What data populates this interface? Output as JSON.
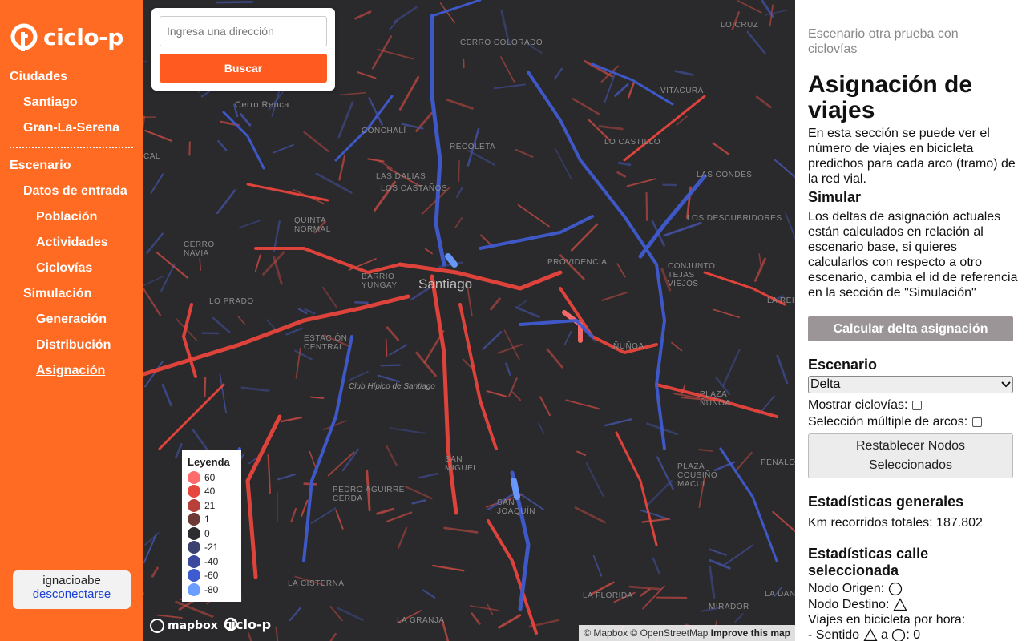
{
  "app": {
    "brand": "ciclo-p"
  },
  "sidebar": {
    "items": [
      {
        "label": "Ciudades"
      },
      {
        "label": "Santiago"
      },
      {
        "label": "Gran-La-Serena"
      },
      {
        "label": "Escenario"
      },
      {
        "label": "Datos de entrada"
      },
      {
        "label": "Población"
      },
      {
        "label": "Actividades"
      },
      {
        "label": "Ciclovías"
      },
      {
        "label": "Simulación"
      },
      {
        "label": "Generación"
      },
      {
        "label": "Distribución"
      },
      {
        "label": "Asignación",
        "active": true
      }
    ],
    "user": {
      "name": "ignacioabe",
      "logout": "desconectarse"
    }
  },
  "search": {
    "placeholder": "Ingresa una dirección",
    "button": "Buscar"
  },
  "map": {
    "city_label": "Santiago",
    "labels": [
      "LO CRUZ",
      "CERRO COLORADO",
      "Cerro Renca",
      "VITACURA",
      "CONCHALÍ",
      "RECOLETA",
      "LO CASTILLO",
      "LAS DALIAS",
      "LOS CASTAÑOS",
      "LAS CONDES",
      "QUINTA NORMAL",
      "LOS DESCUBRIDORES",
      "CERRO NAVIA",
      "PROVIDENCIA",
      "CONJUNTO TEJAS VIEJOS",
      "BARRIO YUNGAY",
      "LO PRADO",
      "LA REINA",
      "ESTACIÓN CENTRAL",
      "ÑUÑOA",
      "PLAZA ÑUÑOA",
      "SAN MIGUEL",
      "PEDRO AGUIRRE CERDA",
      "SAN JOAQUÍN",
      "PEÑALOLÉN",
      "PLAZA COUSIÑO MACUL",
      "LA CISTERNA",
      "LA FLORIDA",
      "LA GRANJA",
      "MIRADOR",
      "CAL",
      "LA DANA"
    ],
    "italic_label": "Club Hípico de Santiago",
    "legend": {
      "title": "Leyenda",
      "items": [
        {
          "label": "60",
          "color": "#ff6b6b"
        },
        {
          "label": "40",
          "color": "#e8453c"
        },
        {
          "label": "21",
          "color": "#b8403a"
        },
        {
          "label": "1",
          "color": "#6e3a35"
        },
        {
          "label": "0",
          "color": "#2d2d30"
        },
        {
          "label": "-21",
          "color": "#3b4272"
        },
        {
          "label": "-40",
          "color": "#3b4a9e"
        },
        {
          "label": "-60",
          "color": "#3f5bd0"
        },
        {
          "label": "-80",
          "color": "#6b9cff"
        }
      ]
    },
    "mapbox": "mapbox",
    "attribution": {
      "prefix": "© Mapbox © OpenStreetMap",
      "improve": "Improve this map"
    }
  },
  "panel": {
    "scenario": "Escenario otra prueba con ciclovías",
    "title": "Asignación de viajes",
    "description": "En esta sección se puede ver el número de viajes en bicicleta predichos para cada arco (tramo) de la red vial.",
    "simulate_heading": "Simular",
    "simulate_text": "Los deltas de asignación actuales están calculados en relación al escenario base, si quieres calcularlos con respecto a otro escenario, cambia el id de referencia en la sección de \"Simulación\"",
    "calc_button": "Calcular delta asignación",
    "scenario_heading": "Escenario",
    "scenario_select": "Delta",
    "show_bikeways": "Mostrar ciclovías:",
    "multi_select": "Selección múltiple de arcos:",
    "reset_button_line1": "Restablecer Nodos",
    "reset_button_line2": "Seleccionados",
    "general_stats_heading": "Estadísticas generales",
    "km_total": "Km recorridos totales: 187.802",
    "street_stats_heading": "Estadísticas calle seleccionada",
    "origin_node": "Nodo Origen:",
    "dest_node": "Nodo Destino:",
    "trips_per_hour": "Viajes en bicicleta por hora:",
    "direction_prefix": "- Sentido",
    "direction_mid": "a",
    "direction_value": ": 0"
  }
}
